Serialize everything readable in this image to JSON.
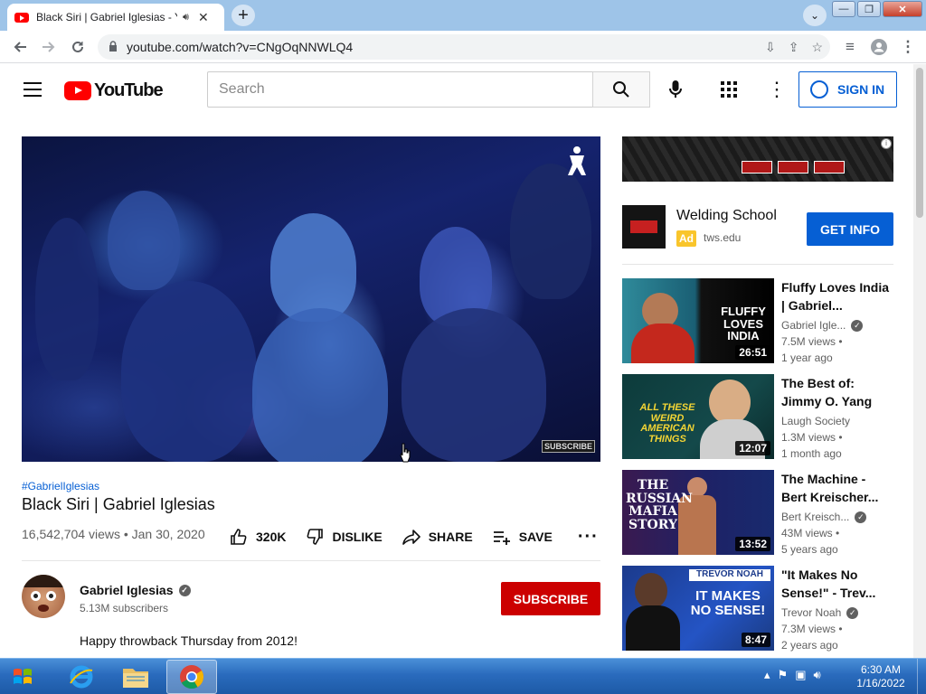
{
  "browser": {
    "tab_title": "Black Siri | Gabriel Iglesias - Y",
    "new_tab_symbol": "+",
    "url": "youtube.com/watch?v=CNgOqNNWLQ4"
  },
  "masthead": {
    "logo_text": "YouTube",
    "search_placeholder": "Search",
    "signin_label": "SIGN IN"
  },
  "video": {
    "hashtag": "#GabrielIglesias",
    "title": "Black Siri | Gabriel Iglesias",
    "views_date": "16,542,704 views • Jan 30, 2020",
    "like_count": "320K",
    "dislike_label": "DISLIKE",
    "share_label": "SHARE",
    "save_label": "SAVE",
    "watermark_subscribe": "SUBSCRIBE"
  },
  "channel": {
    "name": "Gabriel Iglesias",
    "subscribers": "5.13M subscribers",
    "subscribe_label": "SUBSCRIBE",
    "description": "Happy throwback Thursday from 2012!"
  },
  "ad": {
    "title": "Welding School",
    "badge": "Ad",
    "domain": "tws.edu",
    "cta": "GET INFO"
  },
  "related": [
    {
      "title": "Fluffy Loves India | Gabriel...",
      "channel": "Gabriel Igle...",
      "verified": true,
      "views": "7.5M views •",
      "age": "1 year ago",
      "duration": "26:51",
      "thumb_text": "FLUFFY LOVES INDIA"
    },
    {
      "title": "The Best of: Jimmy O. Yang",
      "channel": "Laugh Society",
      "verified": false,
      "views": "1.3M views •",
      "age": "1 month ago",
      "duration": "12:07",
      "thumb_text": "ALL THESE WEIRD AMERICAN THINGS"
    },
    {
      "title": "The Machine - Bert Kreischer...",
      "channel": "Bert Kreisch...",
      "verified": true,
      "views": "43M views •",
      "age": "5 years ago",
      "duration": "13:52",
      "thumb_text": "THE RUSSIAN MAFIA STORY"
    },
    {
      "title": "\"It Makes No Sense!\" - Trev...",
      "channel": "Trevor Noah",
      "verified": true,
      "views": "7.3M views •",
      "age": "2 years ago",
      "duration": "8:47",
      "thumb_text": "IT MAKES NO SENSE!",
      "thumb_name": "TREVOR NOAH"
    }
  ],
  "taskbar": {
    "time": "6:30 AM",
    "date": "1/16/2022"
  },
  "colors": {
    "youtube_red": "#ff0000",
    "subscribe_red": "#cc0000",
    "link_blue": "#065fd4",
    "ad_yellow": "#f9c52b"
  },
  "icons": [
    "youtube-favicon",
    "audio-icon",
    "back-arrow-icon",
    "forward-arrow-icon",
    "reload-icon",
    "lock-icon",
    "install-icon",
    "share-icon",
    "star-icon",
    "media-icon",
    "profile-icon",
    "menu-icon",
    "search-icon",
    "mic-icon",
    "apps-icon",
    "user-icon",
    "like-icon",
    "dislike-icon",
    "share-arrow-icon",
    "save-playlist-icon",
    "verified-icon",
    "windows-start-icon",
    "ie-icon",
    "folder-icon",
    "chrome-icon"
  ]
}
